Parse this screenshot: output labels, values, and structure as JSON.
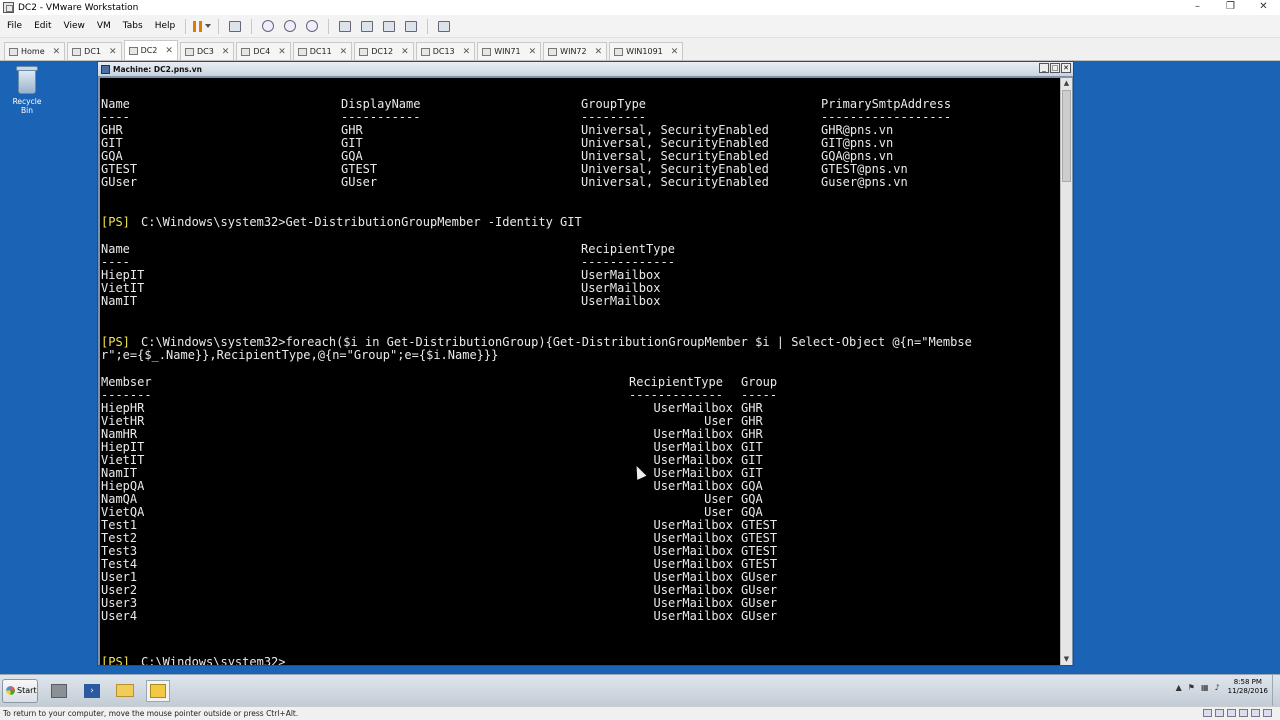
{
  "window": {
    "title": "DC2 - VMware Workstation"
  },
  "menu": [
    "File",
    "Edit",
    "View",
    "VM",
    "Tabs",
    "Help"
  ],
  "tabs": [
    {
      "label": "Home",
      "active": false
    },
    {
      "label": "DC1",
      "active": false
    },
    {
      "label": "DC2",
      "active": true
    },
    {
      "label": "DC3",
      "active": false
    },
    {
      "label": "DC4",
      "active": false
    },
    {
      "label": "DC11",
      "active": false
    },
    {
      "label": "DC12",
      "active": false
    },
    {
      "label": "DC13",
      "active": false
    },
    {
      "label": "WIN71",
      "active": false
    },
    {
      "label": "WIN72",
      "active": false
    },
    {
      "label": "WIN1091",
      "active": false
    }
  ],
  "desktop": {
    "recycle_bin": "Recycle Bin"
  },
  "vm": {
    "title": "Machine: DC2.pns.vn"
  },
  "console": {
    "groups": {
      "headers": [
        "Name",
        "DisplayName",
        "GroupType",
        "PrimarySmtpAddress"
      ],
      "underlines": [
        "----",
        "-----------",
        "---------",
        "------------------"
      ],
      "rows": [
        [
          "GHR",
          "GHR",
          "Universal, SecurityEnabled",
          "GHR@pns.vn"
        ],
        [
          "GIT",
          "GIT",
          "Universal, SecurityEnabled",
          "GIT@pns.vn"
        ],
        [
          "GQA",
          "GQA",
          "Universal, SecurityEnabled",
          "GQA@pns.vn"
        ],
        [
          "GTEST",
          "GTEST",
          "Universal, SecurityEnabled",
          "GTEST@pns.vn"
        ],
        [
          "GUser",
          "GUser",
          "Universal, SecurityEnabled",
          "Guser@pns.vn"
        ]
      ]
    },
    "prompt_tag": "[PS]",
    "cmd1": "C:\\Windows\\system32>Get-DistributionGroupMember -Identity GIT",
    "members": {
      "headers": [
        "Name",
        "RecipientType"
      ],
      "underlines": [
        "----",
        "-------------"
      ],
      "rows": [
        [
          "HiepIT",
          "UserMailbox"
        ],
        [
          "VietIT",
          "UserMailbox"
        ],
        [
          "NamIT",
          "UserMailbox"
        ]
      ]
    },
    "cmd2_line1": "C:\\Windows\\system32>foreach($i in Get-DistributionGroup){Get-DistributionGroupMember $i | Select-Object @{n=\"Membse",
    "cmd2_line2": "r\";e={$_.Name}},RecipientType,@{n=\"Group\";e={$i.Name}}}",
    "all_members": {
      "headers": [
        "Membser",
        "RecipientType",
        "Group"
      ],
      "underlines": [
        "-------",
        "-------------",
        "-----"
      ],
      "rows": [
        [
          "HiepHR",
          "UserMailbox",
          "GHR"
        ],
        [
          "VietHR",
          "User",
          "GHR"
        ],
        [
          "NamHR",
          "UserMailbox",
          "GHR"
        ],
        [
          "HiepIT",
          "UserMailbox",
          "GIT"
        ],
        [
          "VietIT",
          "UserMailbox",
          "GIT"
        ],
        [
          "NamIT",
          "UserMailbox",
          "GIT"
        ],
        [
          "HiepQA",
          "UserMailbox",
          "GQA"
        ],
        [
          "NamQA",
          "User",
          "GQA"
        ],
        [
          "VietQA",
          "User",
          "GQA"
        ],
        [
          "Test1",
          "UserMailbox",
          "GTEST"
        ],
        [
          "Test2",
          "UserMailbox",
          "GTEST"
        ],
        [
          "Test3",
          "UserMailbox",
          "GTEST"
        ],
        [
          "Test4",
          "UserMailbox",
          "GTEST"
        ],
        [
          "User1",
          "UserMailbox",
          "GUser"
        ],
        [
          "User2",
          "UserMailbox",
          "GUser"
        ],
        [
          "User3",
          "UserMailbox",
          "GUser"
        ],
        [
          "User4",
          "UserMailbox",
          "GUser"
        ]
      ]
    },
    "final_prompt": "C:\\Windows\\system32>"
  },
  "taskbar": {
    "start_label": "Start",
    "clock_time": "8:58 PM",
    "clock_date": "11/28/2016"
  },
  "statusbar": {
    "text": "To return to your computer, move the mouse pointer outside or press Ctrl+Alt."
  },
  "colors": {
    "desktop": "#1b64b5",
    "console_bg": "#000000",
    "console_text": "#eaeaea",
    "prompt": "#f2e44a"
  }
}
